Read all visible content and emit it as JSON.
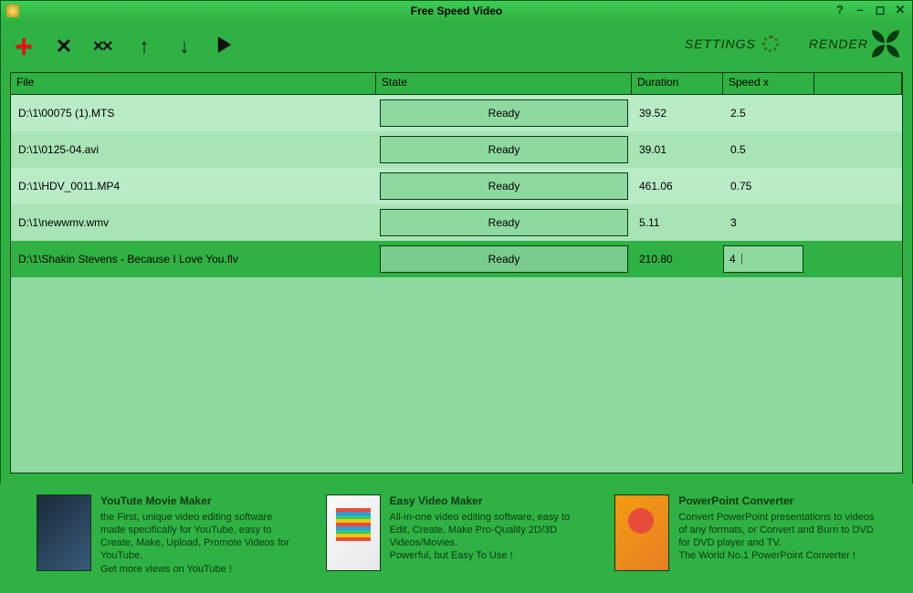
{
  "window": {
    "title": "Free Speed Video"
  },
  "toolbar": {
    "settings_label": "SETTINGS",
    "render_label": "RENDER"
  },
  "table": {
    "headers": {
      "file": "File",
      "state": "State",
      "duration": "Duration",
      "speed": "Speed x"
    },
    "rows": [
      {
        "file": "D:\\1\\00075 (1).MTS",
        "state": "Ready",
        "duration": "39.52",
        "speed": "2.5"
      },
      {
        "file": "D:\\1\\0125-04.avi",
        "state": "Ready",
        "duration": "39.01",
        "speed": "0.5"
      },
      {
        "file": "D:\\1\\HDV_0011.MP4",
        "state": "Ready",
        "duration": "461.06",
        "speed": "0.75"
      },
      {
        "file": "D:\\1\\newwmv.wmv",
        "state": "Ready",
        "duration": "5.11",
        "speed": "3"
      },
      {
        "file": "D:\\1\\Shakin Stevens - Because I Love You.flv",
        "state": "Ready",
        "duration": "210.80",
        "speed": "4"
      }
    ],
    "selected_index": 4
  },
  "ads": [
    {
      "title": "YouTute Movie Maker",
      "body": "the First, unique video editing software made specifically for YouTube, easy to Create, Make, Upload, Promote Videos for YouTube.",
      "footer": "Get more views on YouTube !"
    },
    {
      "title": "Easy Video Maker",
      "body": "All-in-one video editing software, easy to Edit, Create, Make Pro-Quality 2D/3D Videos/Movies.",
      "footer": "Powerful, but Easy To Use !"
    },
    {
      "title": "PowerPoint Converter",
      "body": "Convert PowerPoint presentations to videos of any formats, or Convert and Burn to DVD for DVD player and TV.",
      "footer": "The World No.1 PowerPoint Converter !"
    }
  ]
}
